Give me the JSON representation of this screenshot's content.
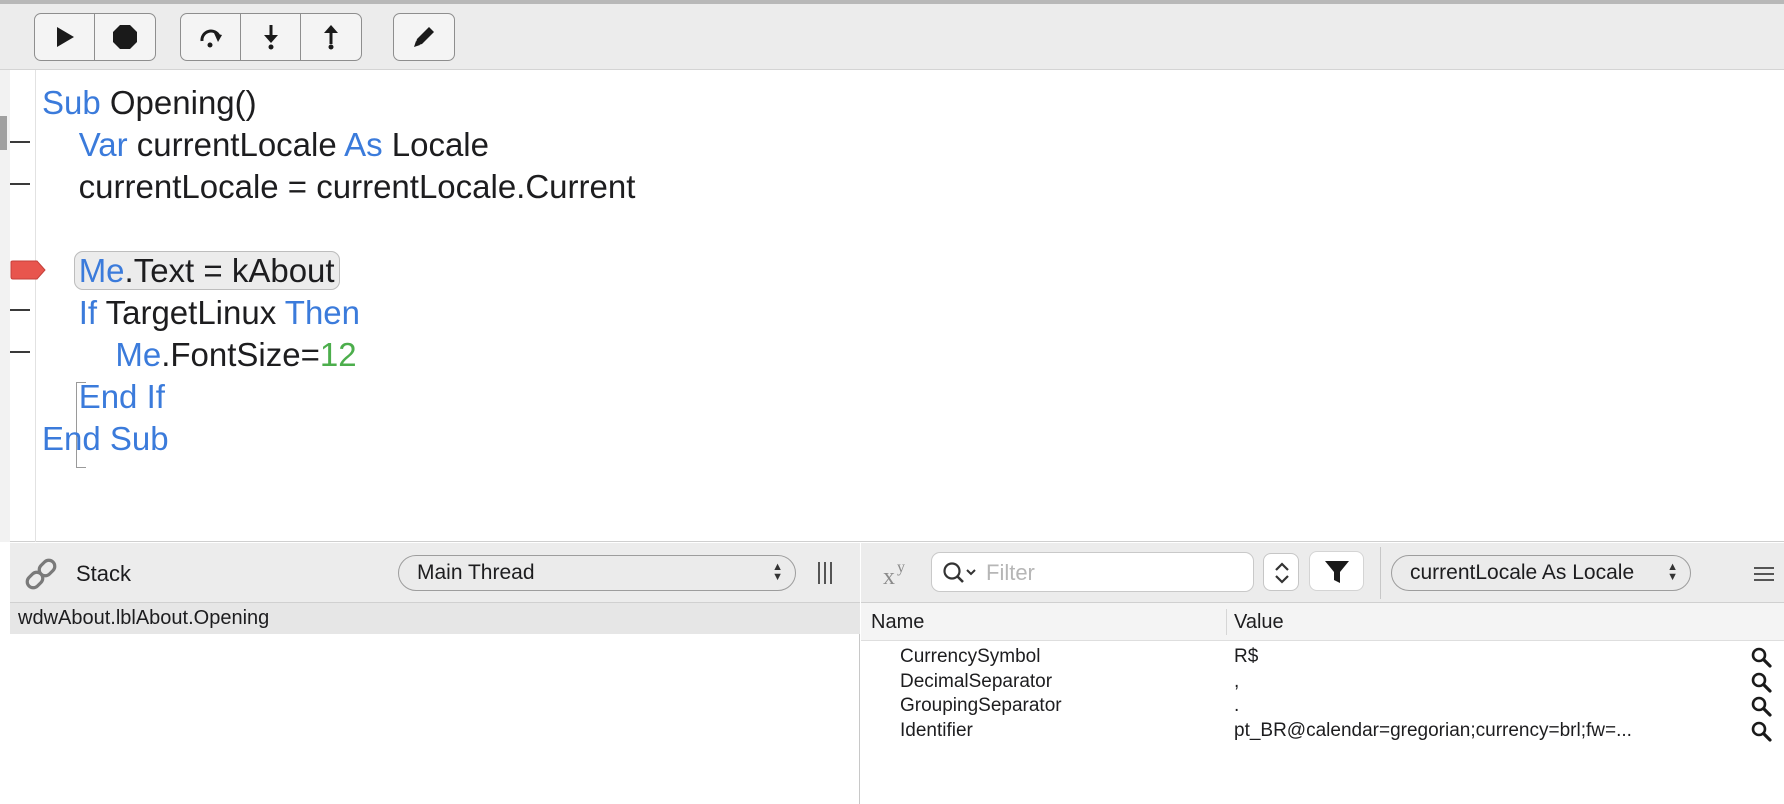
{
  "toolbar": {
    "buttons": [
      {
        "name": "run-button",
        "icon": "play-icon"
      },
      {
        "name": "stop-button",
        "icon": "stop-icon"
      },
      {
        "name": "step-over-button",
        "icon": "step-over-icon"
      },
      {
        "name": "step-in-button",
        "icon": "step-in-icon"
      },
      {
        "name": "step-out-button",
        "icon": "step-out-icon"
      },
      {
        "name": "edit-code-button",
        "icon": "pencil-icon"
      }
    ]
  },
  "editor": {
    "lines": [
      [
        {
          "t": "Sub",
          "c": "kw"
        },
        {
          "t": " Opening()"
        }
      ],
      [
        {
          "t": "    "
        },
        {
          "t": "Var",
          "c": "kw"
        },
        {
          "t": " currentLocale "
        },
        {
          "t": "As",
          "c": "kw"
        },
        {
          "t": " Locale"
        }
      ],
      [
        {
          "t": "    currentLocale = currentLocale.Current"
        }
      ],
      [
        {
          "t": ""
        }
      ],
      [
        {
          "t": "    "
        },
        {
          "t": "Me",
          "c": "kw",
          "hl": true
        },
        {
          "t": ".Text = kAbout",
          "hl": true
        }
      ],
      [
        {
          "t": "    "
        },
        {
          "t": "If",
          "c": "kw"
        },
        {
          "t": " TargetLinux "
        },
        {
          "t": "Then",
          "c": "kw"
        }
      ],
      [
        {
          "t": "        "
        },
        {
          "t": "Me",
          "c": "kw"
        },
        {
          "t": ".FontSize="
        },
        {
          "t": "12",
          "c": "num"
        }
      ],
      [
        {
          "t": "    "
        },
        {
          "t": "End If",
          "c": "kw"
        }
      ],
      [
        {
          "t": "End Sub",
          "c": "kw"
        }
      ]
    ],
    "current_line": 5,
    "breakpoint_color": "#e8554d",
    "keyword_color": "#3b7bdb",
    "number_color": "#4cae4c"
  },
  "stack": {
    "title": "Stack",
    "thread_select": "Main Thread",
    "frames": [
      "wdwAbout.lblAbout.Opening"
    ]
  },
  "variables": {
    "filter_placeholder": "Filter",
    "scope_select": "currentLocale As Locale",
    "columns": {
      "name": "Name",
      "value": "Value"
    },
    "rows": [
      {
        "name": "CurrencySymbol",
        "value": "R$"
      },
      {
        "name": "DecimalSeparator",
        "value": ","
      },
      {
        "name": "GroupingSeparator",
        "value": "."
      },
      {
        "name": "Identifier",
        "value": "pt_BR@calendar=gregorian;currency=brl;fw=..."
      }
    ]
  }
}
